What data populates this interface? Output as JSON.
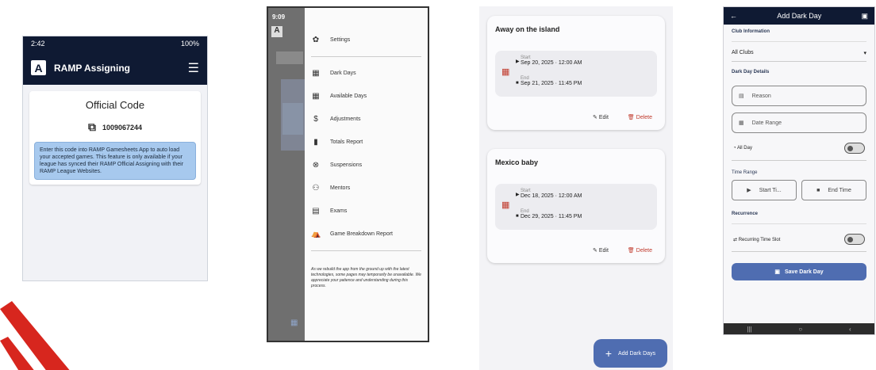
{
  "screen1": {
    "status_time": "2:42",
    "status_right": "100%",
    "logo_letter": "A",
    "app_title": "RAMP Assigning",
    "card_title": "Official Code",
    "code": "1009067244",
    "note": "Enter this code into RAMP Gamesheets App to auto load your accepted games. This feature is only available if your league has synced their RAMP Official Assigning with their RAMP League Websites."
  },
  "screen2": {
    "status_time": "9:09",
    "logo_letter": "A",
    "menu": [
      {
        "label": "Settings",
        "icon": "gear-icon"
      },
      {
        "label": "Dark Days",
        "icon": "calendar-icon"
      },
      {
        "label": "Available Days",
        "icon": "calendar-icon"
      },
      {
        "label": "Adjustments",
        "icon": "dollar-icon"
      },
      {
        "label": "Totals Report",
        "icon": "bar-chart-icon"
      },
      {
        "label": "Suspensions",
        "icon": "cancel-icon"
      },
      {
        "label": "Mentors",
        "icon": "people-icon"
      },
      {
        "label": "Exams",
        "icon": "document-icon"
      },
      {
        "label": "Game Breakdown Report",
        "icon": "report-icon"
      }
    ],
    "disclaimer": "As we rebuild the app from the ground up with the latest technologies, some pages may temporarily be unavailable. We appreciate your patience and understanding during this process."
  },
  "screen3": {
    "events": [
      {
        "title": "Away on the island",
        "start_label": "Start",
        "start": "Sep 20, 2025 · 12:00 AM",
        "end_label": "End",
        "end": "Sep 21, 2025 · 11:45 PM",
        "edit": "Edit",
        "delete": "Delete"
      },
      {
        "title": "Mexico baby",
        "start_label": "Start",
        "start": "Dec 18, 2025 · 12:00 AM",
        "end_label": "End",
        "end": "Dec 29, 2025 · 11:45 PM",
        "edit": "Edit",
        "delete": "Delete"
      }
    ],
    "fab": "Add Dark Days"
  },
  "screen4": {
    "title": "Add Dark Day",
    "club_info": "Club Information",
    "clubs_value": "All Clubs",
    "details": "Dark Day Details",
    "reason_placeholder": "Reason",
    "date_range_placeholder": "Date Range",
    "all_day": "All Day",
    "time_range": "Time Range",
    "start_time": "Start Ti...",
    "end_time": "End Time",
    "recurrence": "Recurrence",
    "recurring": "Recurring Time Slot",
    "save": "Save Dark Day"
  },
  "colors": {
    "navy": "#0f1a33",
    "accent": "#4f6db1",
    "danger": "#c0392b",
    "note_bg": "#a7c9ee"
  }
}
